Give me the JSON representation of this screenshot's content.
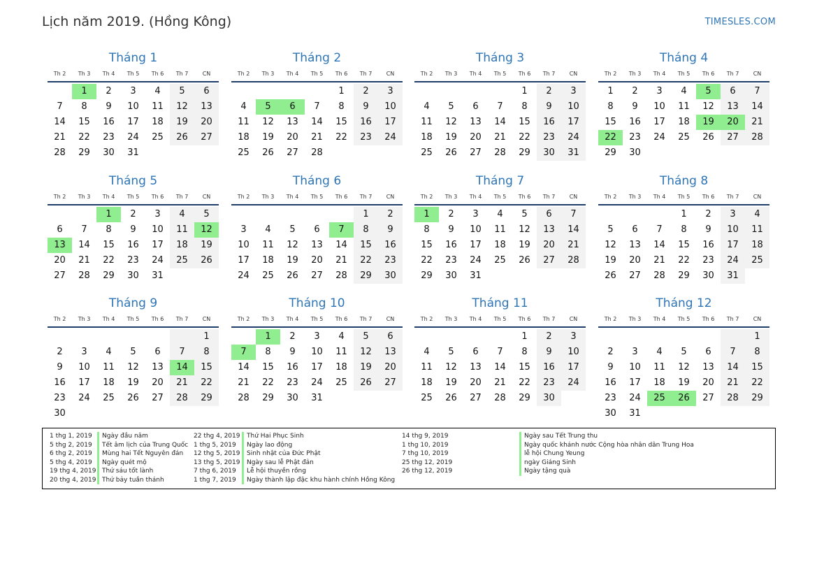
{
  "header": {
    "title": "Lịch năm 2019. (Hồng Kông)",
    "site": "TIMESLES.COM"
  },
  "weekday_labels": [
    "Th 2",
    "Th 3",
    "Th 4",
    "Th 5",
    "Th 6",
    "Th 7",
    "CN"
  ],
  "colors": {
    "accent": "#2e75b6",
    "holiday": "#90ee90",
    "weekend": "#f2f2f2"
  },
  "months": [
    {
      "name": "Tháng 1",
      "start": 1,
      "days": 31,
      "holidays": [
        1
      ]
    },
    {
      "name": "Tháng 2",
      "start": 4,
      "days": 28,
      "holidays": [
        5,
        6
      ]
    },
    {
      "name": "Tháng 3",
      "start": 4,
      "days": 31,
      "holidays": []
    },
    {
      "name": "Tháng 4",
      "start": 0,
      "days": 30,
      "holidays": [
        5,
        19,
        20,
        22
      ]
    },
    {
      "name": "Tháng 5",
      "start": 2,
      "days": 31,
      "holidays": [
        1,
        12,
        13
      ]
    },
    {
      "name": "Tháng 6",
      "start": 5,
      "days": 30,
      "holidays": [
        7
      ]
    },
    {
      "name": "Tháng 7",
      "start": 0,
      "days": 31,
      "holidays": [
        1
      ]
    },
    {
      "name": "Tháng 8",
      "start": 3,
      "days": 31,
      "holidays": []
    },
    {
      "name": "Tháng 9",
      "start": 6,
      "days": 30,
      "holidays": [
        14
      ]
    },
    {
      "name": "Tháng 10",
      "start": 1,
      "days": 31,
      "holidays": [
        1,
        7
      ]
    },
    {
      "name": "Tháng 11",
      "start": 4,
      "days": 30,
      "holidays": []
    },
    {
      "name": "Tháng 12",
      "start": 6,
      "days": 31,
      "holidays": [
        25,
        26
      ]
    }
  ],
  "legend": {
    "col1": [
      {
        "date": "1 thg 1, 2019",
        "name": "Ngày đầu năm"
      },
      {
        "date": "5 thg 2, 2019",
        "name": "Tết âm lịch của Trung Quốc"
      },
      {
        "date": "6 thg 2, 2019",
        "name": "Mùng hai Tết Nguyên đán"
      },
      {
        "date": "5 thg 4, 2019",
        "name": "Ngày quét mộ"
      },
      {
        "date": "19 thg 4, 2019",
        "name": "Thứ sáu tốt lành"
      },
      {
        "date": "20 thg 4, 2019",
        "name": "Thứ bảy tuần thánh"
      }
    ],
    "col2": [
      {
        "date": "22 thg 4, 2019",
        "name": "Thứ Hai Phục Sinh"
      },
      {
        "date": "1 thg 5, 2019",
        "name": "Ngày lao động"
      },
      {
        "date": "12 thg 5, 2019",
        "name": "Sinh nhật của Đức Phật"
      },
      {
        "date": "13 thg 5, 2019",
        "name": "Ngày sau lễ Phật đản"
      },
      {
        "date": "7 thg 6, 2019",
        "name": "Lễ hội thuyền rồng"
      },
      {
        "date": "1 thg 7, 2019",
        "name": "Ngày thành lập đặc khu hành chính Hồng Kông"
      }
    ],
    "col3": [
      {
        "date": "14 thg 9, 2019",
        "name": "Ngày sau Tết Trung thu"
      },
      {
        "date": "1 thg 10, 2019",
        "name": "Ngày quốc khánh nước Cộng hòa nhân dân Trung Hoa"
      },
      {
        "date": "7 thg 10, 2019",
        "name": "lễ hội Chung Yeung"
      },
      {
        "date": "25 thg 12, 2019",
        "name": "ngày Giáng Sinh"
      },
      {
        "date": "26 thg 12, 2019",
        "name": "Ngày tặng quà"
      }
    ]
  }
}
